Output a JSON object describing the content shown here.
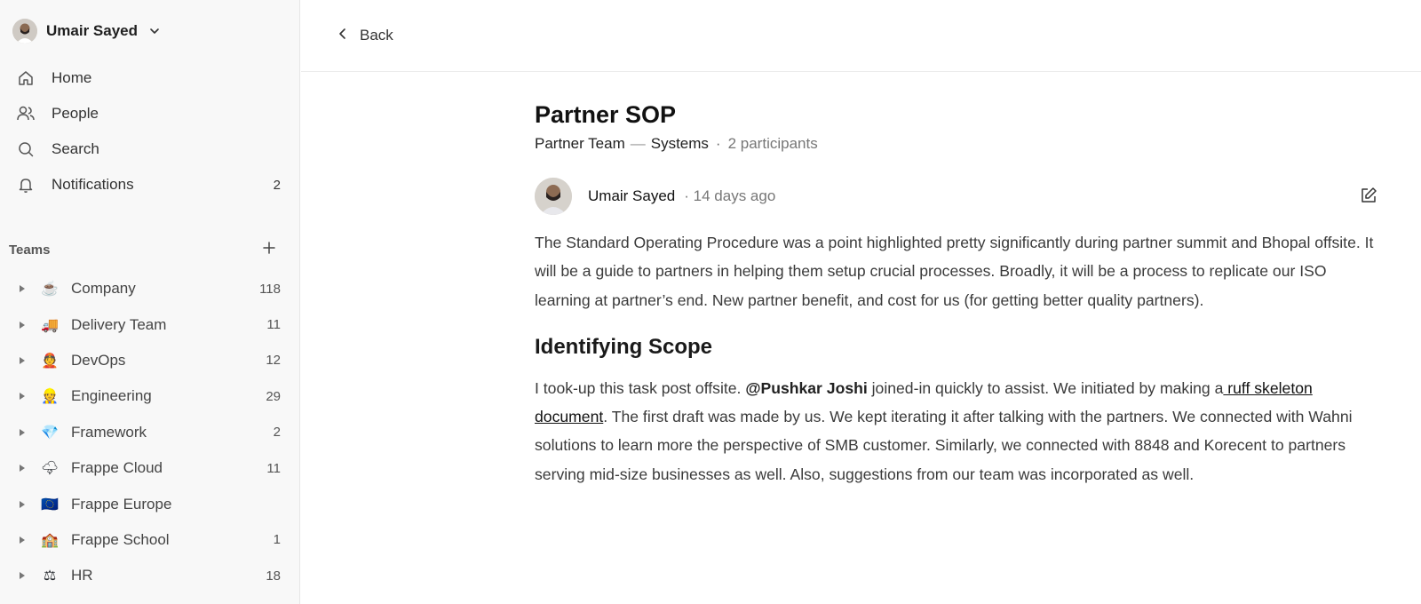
{
  "sidebar": {
    "user": {
      "name": "Umair Sayed"
    },
    "nav": [
      {
        "label": "Home",
        "icon": "home-icon",
        "count": ""
      },
      {
        "label": "People",
        "icon": "people-icon",
        "count": ""
      },
      {
        "label": "Search",
        "icon": "search-icon",
        "count": ""
      },
      {
        "label": "Notifications",
        "icon": "bell-icon",
        "count": "2"
      }
    ],
    "teams_label": "Teams",
    "teams": [
      {
        "emoji": "☕",
        "name": "Company",
        "count": "118"
      },
      {
        "emoji": "🚚",
        "name": "Delivery Team",
        "count": "11"
      },
      {
        "emoji": "👲",
        "name": "DevOps",
        "count": "12"
      },
      {
        "emoji": "👷",
        "name": "Engineering",
        "count": "29"
      },
      {
        "emoji": "💎",
        "name": "Framework",
        "count": "2"
      },
      {
        "emoji": "🌩",
        "name": "Frappe Cloud",
        "count": "11"
      },
      {
        "emoji": "🇪🇺",
        "name": "Frappe Europe",
        "count": ""
      },
      {
        "emoji": "🏫",
        "name": "Frappe School",
        "count": "1"
      },
      {
        "emoji": "⚖",
        "name": "HR",
        "count": "18"
      }
    ]
  },
  "topbar": {
    "back_label": "Back"
  },
  "discussion": {
    "title": "Partner SOP",
    "team": "Partner Team",
    "separator": "—",
    "project": "Systems",
    "dot": "·",
    "participants": "2 participants",
    "author": "Umair Sayed",
    "time": "· 14 days ago",
    "paragraph1": "The Standard Operating Procedure was a point highlighted pretty significantly during partner summit and Bhopal offsite. It will be a guide to partners in helping them setup crucial processes. Broadly, it will be a process to replicate our ISO learning at partner’s end. New partner benefit, and cost for us (for getting better quality partners).",
    "heading": "Identifying Scope",
    "p2_before": "I took-up this task post offsite. ",
    "p2_mention": "@Pushkar Joshi",
    "p2_middle": "  joined-in quickly to assist. We initiated by making a",
    "p2_link": " ruff skeleton document",
    "p2_after": ". The first draft was made by us. We kept iterating it after talking with the partners. We connected with Wahni solutions to learn more the perspective of SMB customer. Similarly, we connected with 8848 and Korecent to partners serving mid-size businesses as well. Also, suggestions from our team was incorporated as well."
  }
}
